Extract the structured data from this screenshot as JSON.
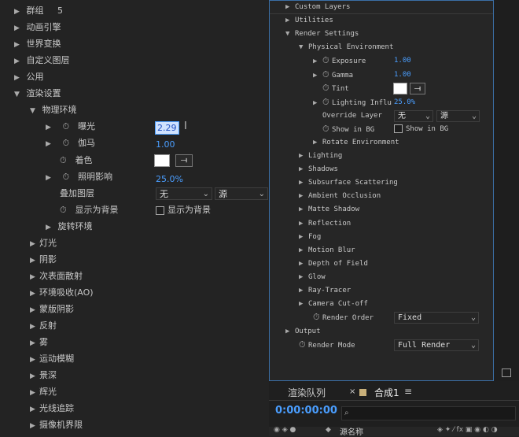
{
  "left": {
    "top_partial": {
      "label": "群组",
      "count": "5"
    },
    "groups": [
      "动画引擎",
      "世界变换",
      "自定义图层",
      "公用"
    ],
    "render_settings": "渲染设置",
    "physical_env": "物理环境",
    "exposure": {
      "label": "曝光",
      "value": "2.29"
    },
    "gamma": {
      "label": "伽马",
      "value": "1.00"
    },
    "tint": {
      "label": "着色"
    },
    "lighting": {
      "label": "照明影响",
      "value": "25.0%"
    },
    "override": {
      "label": "叠加图层",
      "opt1": "无",
      "opt2": "源"
    },
    "show_bg": {
      "label": "显示为背景",
      "checkbox": "显示为背景"
    },
    "rotate": "旋转环境",
    "subgroups": [
      "灯光",
      "阴影",
      "次表面散射",
      "环境吸收(AO)",
      "蒙版阴影",
      "反射",
      "雾",
      "运动模糊",
      "景深",
      "辉光",
      "光线追踪",
      "摄像机界限"
    ]
  },
  "right": {
    "top_items": [
      "Custom Layers",
      "Utilities"
    ],
    "render_settings": "Render Settings",
    "physical_env": "Physical Environment",
    "exposure": {
      "label": "Exposure",
      "value": "1.00"
    },
    "gamma": {
      "label": "Gamma",
      "value": "1.00"
    },
    "tint": {
      "label": "Tint"
    },
    "lighting": {
      "label": "Lighting Influ",
      "value": "25.0%"
    },
    "override": {
      "label": "Override Layer",
      "opt1": "无",
      "opt2": "源"
    },
    "show_bg": {
      "checkbox": "Show in BG",
      "label": "Show in BG"
    },
    "rotate": "Rotate Environment",
    "subgroups": [
      "Lighting",
      "Shadows",
      "Subsurface Scattering",
      "Ambient Occlusion",
      "Matte Shadow",
      "Reflection",
      "Fog",
      "Motion Blur",
      "Depth of Field",
      "Glow",
      "Ray-Tracer",
      "Camera Cut-off"
    ],
    "render_order": {
      "label": "Render Order",
      "value": "Fixed"
    },
    "output": "Output",
    "render_mode": {
      "label": "Render Mode",
      "value": "Full Render"
    }
  },
  "bottom": {
    "tab_queue": "渲染队列",
    "tab_comp": "合成1",
    "timecode": "0:00:00:00",
    "col_source": "源名称"
  }
}
